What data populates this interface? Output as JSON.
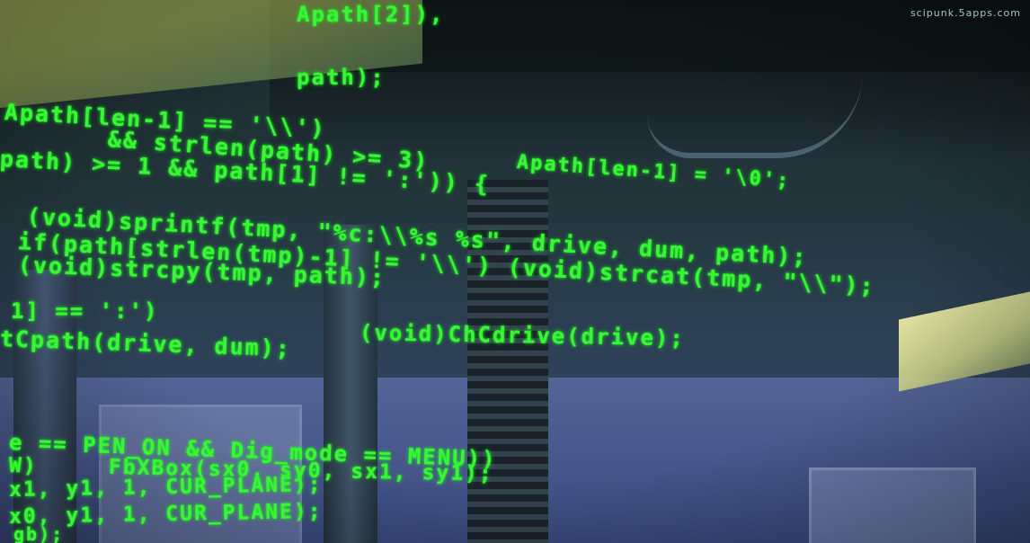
{
  "watermark": "scipunk.5apps.com",
  "code_lines": [
    "Apath[2]),",
    "path);",
    "Apath[len-1] == '\\\\')",
    "&& strlen(path) >= 3)",
    "Apath[len-1] = '\\0';",
    "path) >= 1 && path[1] != ':')) {",
    "(void)sprintf(tmp, \"%c:\\\\%s %s\", drive, dum, path);",
    "if(path[strlen(tmp)-1] != '\\\\') (void)strcat(tmp, \"\\\\\");",
    "(void)strcpy(tmp, path);",
    "1] == ':')",
    "(void)ChCdrive(drive);",
    "tCpath(drive, dum);",
    "e == PEN_ON && Dig_mode == MENU))",
    "W)     FbXBox(sx0, sy0, sx1, sy1);",
    "x1, y1, 1, CUR_PLANE);",
    "x0, y1, 1, CUR_PLANE);",
    "gb);"
  ]
}
